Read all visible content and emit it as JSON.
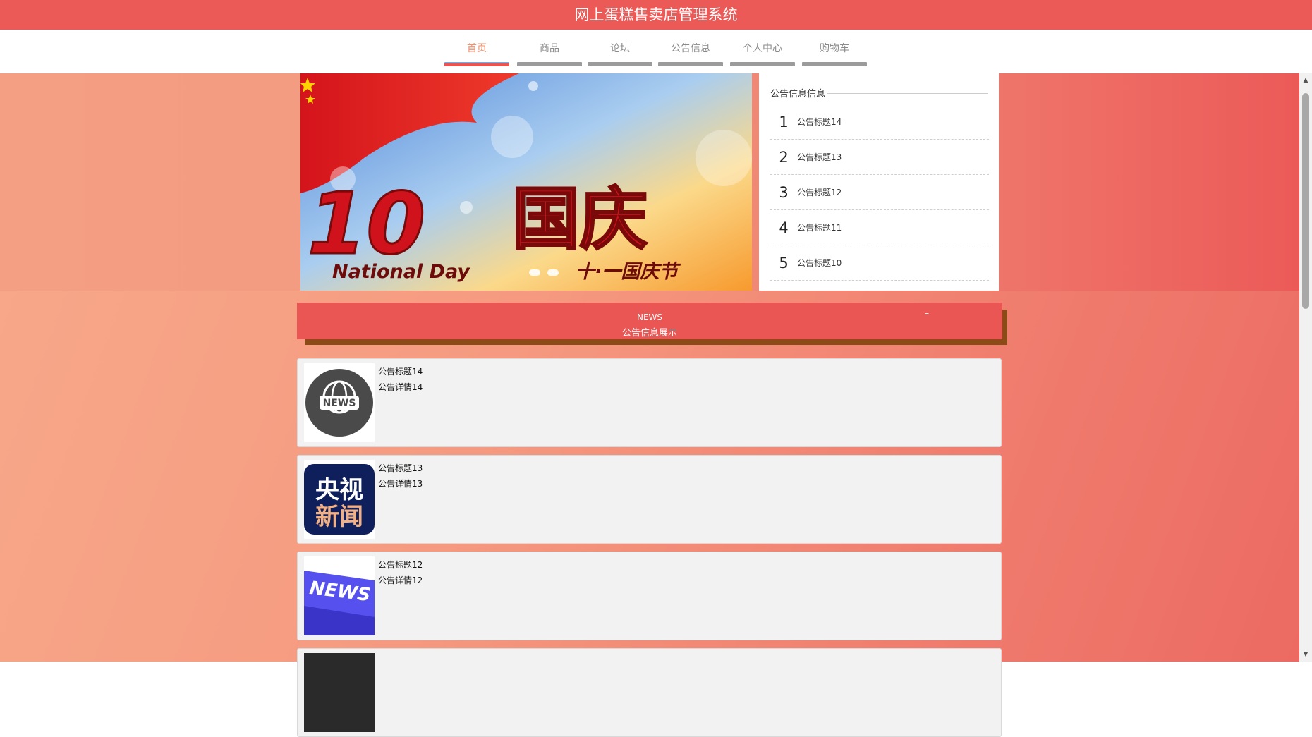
{
  "header": {
    "title": "网上蛋糕售卖店管理系统"
  },
  "nav": {
    "items": [
      {
        "label": "首页",
        "active": true
      },
      {
        "label": "商品",
        "active": false
      },
      {
        "label": "论坛",
        "active": false
      },
      {
        "label": "公告信息",
        "active": false
      },
      {
        "label": "个人中心",
        "active": false
      },
      {
        "label": "购物车",
        "active": false
      }
    ]
  },
  "banner": {
    "big_text": "国庆",
    "english_text": "National Day",
    "chinese_text": "十·一国庆节",
    "slide_count": 2
  },
  "notice_panel": {
    "heading": "公告信息信息",
    "items": [
      {
        "num": "1",
        "title": "公告标题14"
      },
      {
        "num": "2",
        "title": "公告标题13"
      },
      {
        "num": "3",
        "title": "公告标题12"
      },
      {
        "num": "4",
        "title": "公告标题11"
      },
      {
        "num": "5",
        "title": "公告标题10"
      }
    ]
  },
  "news_section": {
    "label_en": "NEWS",
    "label_cn": "公告信息展示",
    "more": "–",
    "cards": [
      {
        "title": "公告标题14",
        "detail": "公告详情14",
        "thumb_icon": "globe-news-icon",
        "thumb_text": "NEWS"
      },
      {
        "title": "公告标题13",
        "detail": "公告详情13",
        "thumb_icon": "cctv-news-icon",
        "thumb_text": "央视新闻"
      },
      {
        "title": "公告标题12",
        "detail": "公告详情12",
        "thumb_icon": "news-key-icon",
        "thumb_text": "NEWS"
      }
    ]
  },
  "colors": {
    "primary_red": "#ec5a57",
    "nav_active": "#f0916b",
    "header_shadow": "#8b4b17"
  }
}
